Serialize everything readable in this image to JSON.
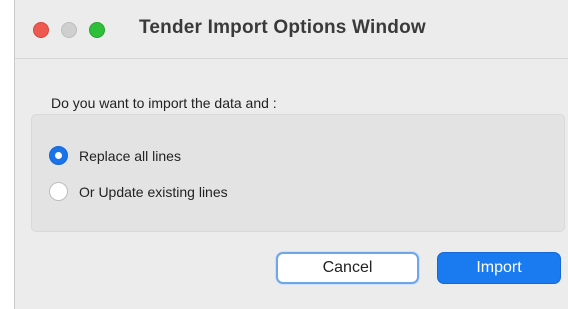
{
  "window": {
    "title": "Tender Import Options Window"
  },
  "dialog": {
    "question": "Do you want to import the data and :",
    "options": [
      {
        "label": "Replace all lines",
        "selected": true
      },
      {
        "label": "Or Update existing lines",
        "selected": false
      }
    ]
  },
  "buttons": {
    "cancel_label": "Cancel",
    "import_label": "Import"
  },
  "colors": {
    "accent": "#1a7bf0",
    "close": "#ee5a52",
    "zoom": "#2fbf3a"
  }
}
